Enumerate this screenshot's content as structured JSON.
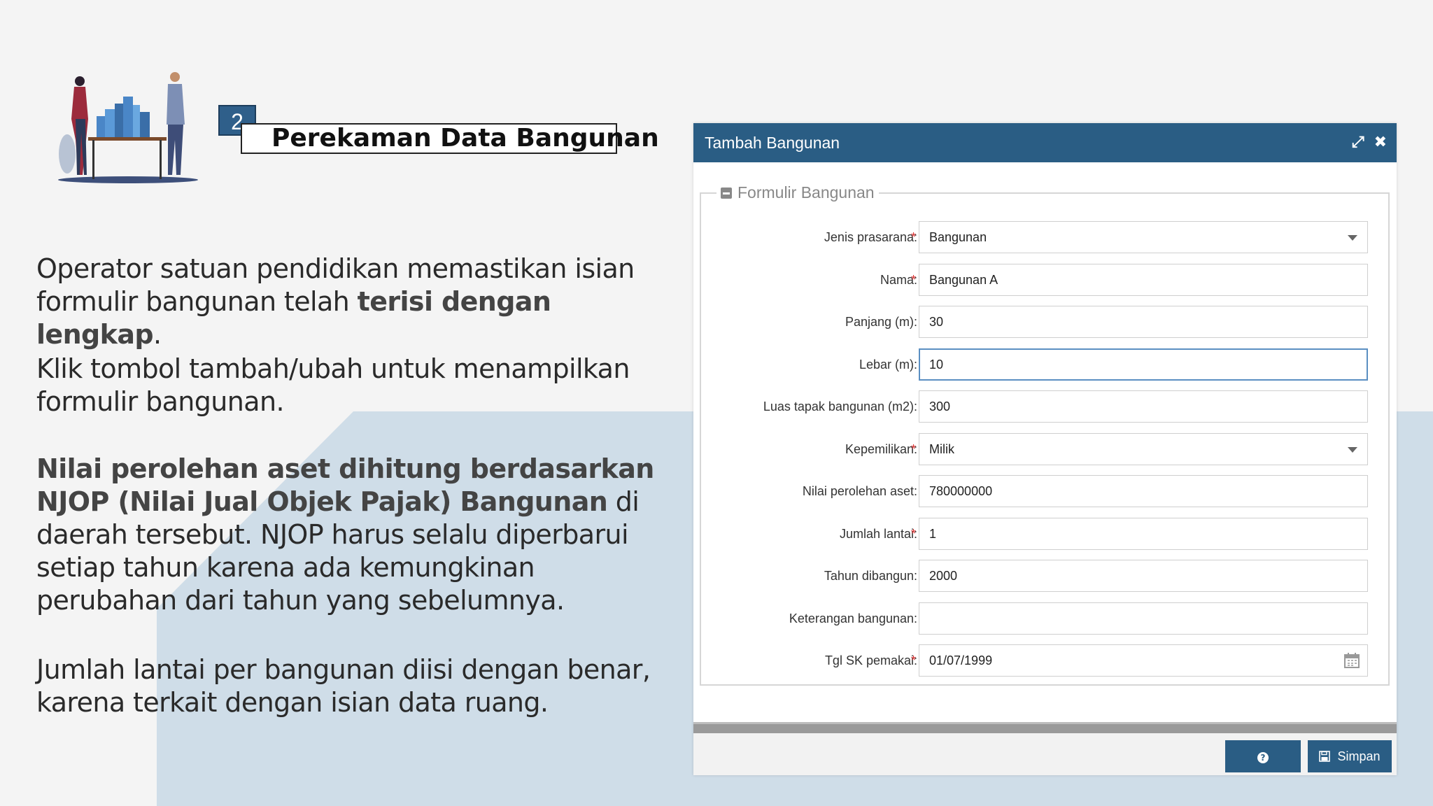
{
  "slide": {
    "step_number": "2",
    "title": "Perekaman Data Bangunan",
    "para1_a": "Operator satuan pendidikan memastikan isian formulir bangunan telah ",
    "para1_b": "terisi dengan lengkap",
    "para1_c": ".",
    "para2": "Klik tombol tambah/ubah untuk menampilkan formulir bangunan.",
    "para3_a": "Nilai perolehan aset dihitung berdasarkan NJOP (Nilai Jual Objek Pajak) Bangunan",
    "para3_b": " di daerah tersebut. NJOP harus selalu diperbarui setiap tahun karena ada kemungkinan perubahan dari tahun yang sebelumnya.",
    "para4": "Jumlah lantai per bangunan diisi dengan benar, karena terkait dengan isian data ruang."
  },
  "dialog": {
    "title": "Tambah Bangunan",
    "fieldset_legend": "Formulir Bangunan",
    "fields": [
      {
        "label": "Jenis prasarana:",
        "required": "*",
        "value": "Bangunan"
      },
      {
        "label": "Nama:",
        "required": "*",
        "value": "Bangunan A"
      },
      {
        "label": "Panjang (m):",
        "required": "",
        "value": "30"
      },
      {
        "label": "Lebar (m):",
        "required": "",
        "value": "10"
      },
      {
        "label": "Luas tapak bangunan (m2):",
        "required": "",
        "value": "300"
      },
      {
        "label": "Kepemilikan:",
        "required": "*",
        "value": "Milik"
      },
      {
        "label": "Nilai perolehan aset:",
        "required": "",
        "value": "780000000"
      },
      {
        "label": "Jumlah lantai:",
        "required": "*",
        "value": "1"
      },
      {
        "label": "Tahun dibangun:",
        "required": "",
        "value": "2000"
      },
      {
        "label": "Keterangan bangunan:",
        "required": "",
        "value": ""
      },
      {
        "label": "Tgl SK pemakai:",
        "required": "*",
        "value": "01/07/1999"
      }
    ],
    "save_label": "Simpan",
    "help_glyph": "?",
    "icons": {
      "maximize": "expand-icon",
      "close": "close-icon",
      "calendar": "calendar-icon",
      "save": "floppy-icon"
    }
  },
  "colors": {
    "header": "#2a5d84",
    "background_shape": "#cfdde8",
    "required": "#d33333"
  }
}
